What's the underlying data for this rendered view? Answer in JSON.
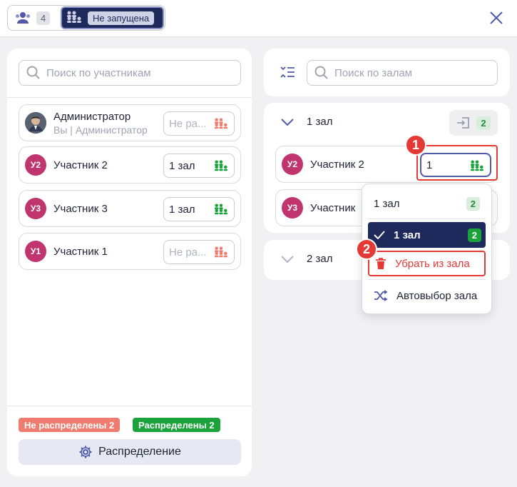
{
  "topbar": {
    "participants_count": "4",
    "session_status": "Не запущена"
  },
  "left": {
    "search_placeholder": "Поиск по участникам",
    "participants": [
      {
        "name": "Администратор",
        "sub": "Вы | Администратор",
        "hall": "Не ра...",
        "avatar": "photo"
      },
      {
        "name": "Участник 2",
        "initials": "У2",
        "hall": "1 зал"
      },
      {
        "name": "Участник 3",
        "initials": "У3",
        "hall": "1 зал"
      },
      {
        "name": "Участник 1",
        "initials": "У1",
        "hall": "Не ра..."
      }
    ],
    "not_distributed": "Не распределены 2",
    "distributed": "Распределены 2",
    "distribution_button": "Распределение"
  },
  "right": {
    "search_placeholder": "Поиск по залам",
    "halls": [
      {
        "name": "1 зал",
        "count": "2",
        "members": [
          {
            "name": "Участник 2",
            "initials": "У2",
            "hall_value": "1"
          },
          {
            "name": "Участник",
            "initials": "У3"
          }
        ]
      },
      {
        "name": "2 зал"
      }
    ]
  },
  "menu": {
    "items": [
      {
        "label": "1 зал",
        "count": "2"
      },
      {
        "label": "1 зал",
        "count": "2",
        "selected": true
      },
      {
        "label": "Убрать из зала",
        "danger": true
      },
      {
        "label": "Автовыбор зала"
      }
    ]
  },
  "markers": [
    "1",
    "2"
  ],
  "colors": {
    "accent": "#1f2a5c",
    "danger": "#e53935",
    "success": "#1aa33b",
    "avatar": "#c0356e",
    "not_distributed": "#ef7c6e"
  }
}
